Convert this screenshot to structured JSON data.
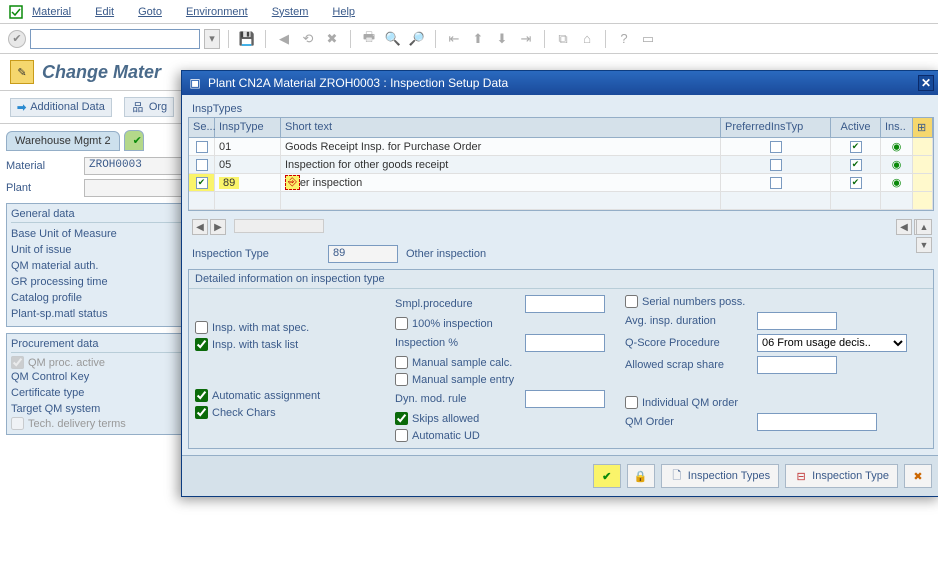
{
  "menu": {
    "items": [
      "Material",
      "Edit",
      "Goto",
      "Environment",
      "System",
      "Help"
    ]
  },
  "title": "Change Mater",
  "subbar": {
    "additional": "Additional Data",
    "org": "Org"
  },
  "tabs": {
    "warehouse": "Warehouse Mgmt 2"
  },
  "fields": {
    "material_label": "Material",
    "material_value": "ZROH0003",
    "plant_label": "Plant",
    "plant_value": ""
  },
  "groups": {
    "general": {
      "title": "General data",
      "items": [
        "Base Unit of Measure",
        "Unit of issue",
        "QM material auth.",
        "GR processing time",
        "Catalog profile",
        "Plant-sp.matl status"
      ]
    },
    "procurement": {
      "title": "Procurement data",
      "qm_proc": "QM proc. active",
      "items": [
        "QM Control Key",
        "Certificate type",
        "Target QM system"
      ],
      "tech": "Tech. delivery terms"
    }
  },
  "dialog": {
    "title": "Plant CN2A Material ZROH0003 : Inspection Setup Data",
    "panel_label": "InspTypes",
    "headers": {
      "se": "Se...",
      "it": "InspType",
      "st": "Short text",
      "pr": "PreferredInsTyp",
      "ac": "Active",
      "in": "Ins.."
    },
    "rows": [
      {
        "sel": false,
        "type": "01",
        "text": "Goods Receipt Insp. for Purchase Order",
        "active": true
      },
      {
        "sel": false,
        "type": "05",
        "text": "Inspection for other goods receipt",
        "active": true
      },
      {
        "sel": true,
        "type": "89",
        "text": "er inspection",
        "active": true,
        "hl": true
      }
    ],
    "insp_type_label": "Inspection Type",
    "insp_type_value": "89",
    "insp_type_text": "Other inspection",
    "detail_title": "Detailed information on inspection type",
    "col1": {
      "with_mat": "Insp. with mat spec.",
      "with_task": "Insp. with task list",
      "auto_assign": "Automatic assignment",
      "check_chars": "Check Chars"
    },
    "col2": {
      "smpl": "Smpl.procedure",
      "hundred": "100% inspection",
      "insp_pct": "Inspection %",
      "manual_calc": "Manual sample calc.",
      "manual_entry": "Manual sample entry",
      "dyn_mod": "Dyn. mod. rule",
      "skips": "Skips allowed",
      "auto_ud": "Automatic UD"
    },
    "col3": {
      "serial": "Serial numbers poss.",
      "avg": "Avg. insp. duration",
      "qscore": "Q-Score Procedure",
      "qscore_val": "06 From usage decis..",
      "scrap": "Allowed scrap share",
      "indiv": "Individual QM order",
      "qmorder": "QM Order"
    },
    "footer": {
      "insp_types": "Inspection Types",
      "insp_type": "Inspection Type"
    }
  }
}
